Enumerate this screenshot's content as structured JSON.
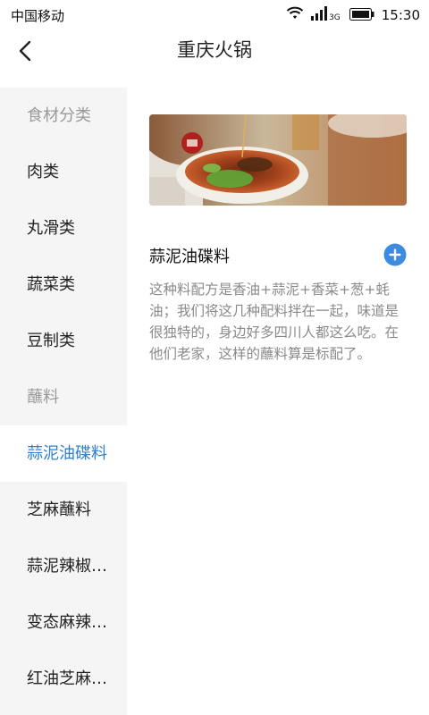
{
  "status_bar": {
    "carrier": "中国移动",
    "network": "3G",
    "time": "15:30"
  },
  "nav": {
    "title": "重庆火锅"
  },
  "sidebar": {
    "group_ingredients": "食材分类",
    "ingredients": [
      "肉类",
      "丸滑类",
      "蔬菜类",
      "豆制类"
    ],
    "group_sauces": "蘸料",
    "sauces": [
      "蒜泥油碟料",
      "芝麻蘸料",
      "蒜泥辣椒蘸料",
      "变态麻辣蘸料",
      "红油芝麻蘸料"
    ],
    "active_sauce": "蒜泥油碟料"
  },
  "detail": {
    "title": "蒜泥油碟料",
    "description": "这种料配方是香油+蒜泥+香菜+葱+蚝油；我们将这几种配料拌在一起，味道是很独特的，身边好多四川人都这么吃。在他们老家，这样的蘸料算是标配了。",
    "image_icon": "hotpot-sauce-photo"
  },
  "colors": {
    "accent": "#2f7fd1",
    "add_button": "#3d8be0",
    "sidebar_bg": "#f5f5f5"
  }
}
